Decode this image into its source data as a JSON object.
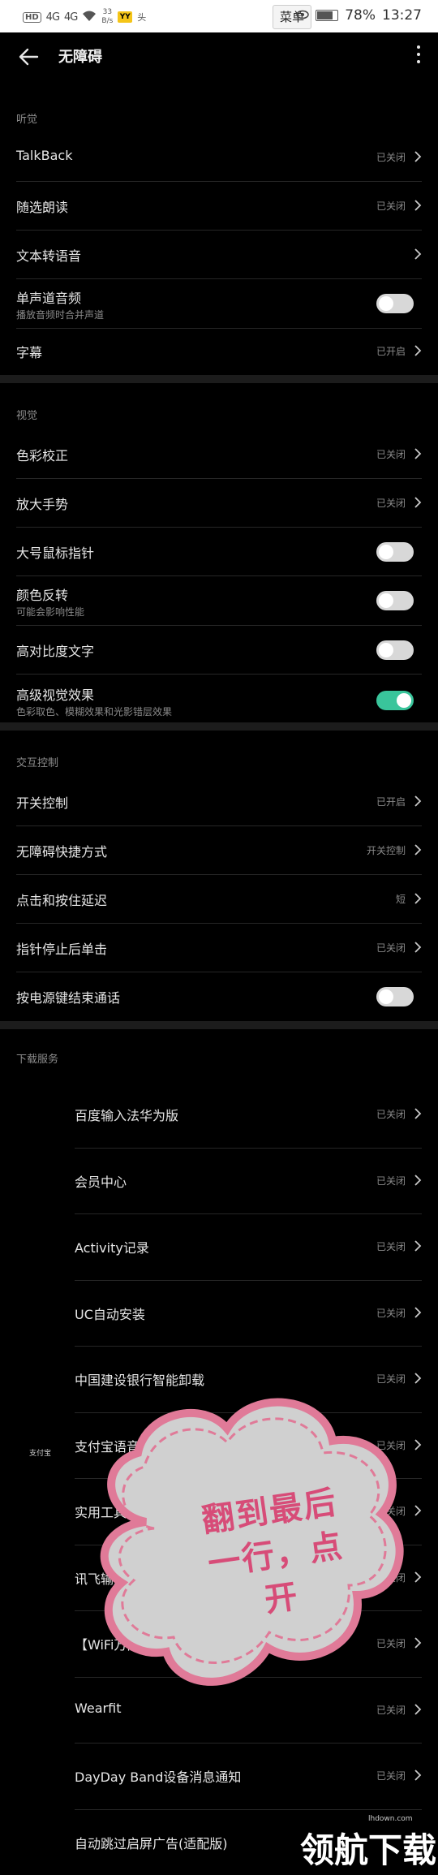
{
  "status_bar": {
    "hd": "HD",
    "signal1": "4G",
    "signal2": "4G",
    "speed_value": "33",
    "speed_unit": "B/s",
    "yellow_app": "YY",
    "extra": "头",
    "menu_button": "菜单",
    "battery": "78%",
    "time": "13:27"
  },
  "app_bar": {
    "title": "无障碍"
  },
  "hearing": {
    "header": "听觉",
    "items": [
      {
        "title": "TalkBack",
        "value": "已关闭"
      },
      {
        "title": "随选朗读",
        "value": "已关闭"
      },
      {
        "title": "文本转语音",
        "value": ""
      },
      {
        "title": "单声道音频",
        "subtitle": "播放音频时合并声道",
        "toggle": false
      },
      {
        "title": "字幕",
        "value": "已开启"
      }
    ]
  },
  "vision": {
    "header": "视觉",
    "items": [
      {
        "title": "色彩校正",
        "value": "已关闭"
      },
      {
        "title": "放大手势",
        "value": "已关闭"
      },
      {
        "title": "大号鼠标指针",
        "toggle": false
      },
      {
        "title": "颜色反转",
        "subtitle": "可能会影响性能",
        "toggle": false
      },
      {
        "title": "高对比度文字",
        "toggle": false
      },
      {
        "title": "高级视觉效果",
        "subtitle": "色彩取色、模糊效果和光影错层效果",
        "toggle": true
      }
    ]
  },
  "interaction": {
    "header": "交互控制",
    "items": [
      {
        "title": "开关控制",
        "value": "已开启"
      },
      {
        "title": "无障碍快捷方式",
        "value": "开关控制"
      },
      {
        "title": "点击和按住延迟",
        "value": "短"
      },
      {
        "title": "指针停止后单击",
        "value": "已关闭"
      },
      {
        "title": "按电源键结束通话",
        "toggle": false
      }
    ]
  },
  "downloaded": {
    "header": "下载服务",
    "side_label": "支付宝",
    "items": [
      {
        "title": "百度输入法华为版",
        "value": "已关闭"
      },
      {
        "title": "会员中心",
        "value": "已关闭"
      },
      {
        "title": "Activity记录",
        "value": "已关闭"
      },
      {
        "title": "UC自动安装",
        "value": "已关闭"
      },
      {
        "title": "中国建设银行智能卸载",
        "value": "已关闭"
      },
      {
        "title": "支付宝语音权限助手",
        "value": "已关闭"
      },
      {
        "title": "实用工具箱",
        "value": "已关闭"
      },
      {
        "title": "讯飞输入法",
        "value": "已关闭"
      },
      {
        "title": "【WiFi万能钥匙极速版】- 请开启",
        "value": "已关闭"
      },
      {
        "title": "Wearfit",
        "value": "已关闭"
      },
      {
        "title": "DayDay Band设备消息通知",
        "value": "已关闭"
      },
      {
        "title": "自动跳过启屏广告(适配版)",
        "value": ""
      }
    ]
  },
  "overlay": {
    "cloud_line1": "翻到最后",
    "cloud_line2": "一行，点",
    "cloud_line3": "开",
    "accent_color": "#d74c78"
  },
  "watermark": {
    "text": "领航下载",
    "site": "lhdown.com"
  },
  "colors": {
    "toggle_on": "#39c59b",
    "toggle_off": "#d8d8d8",
    "background": "#000000"
  }
}
